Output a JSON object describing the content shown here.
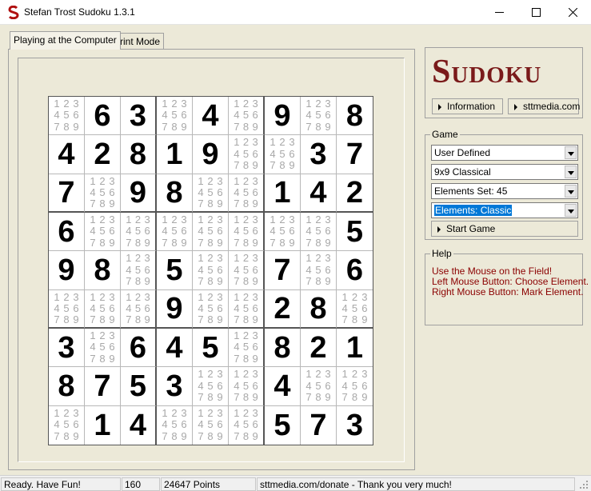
{
  "window": {
    "title": "Stefan Trost Sudoku 1.3.1"
  },
  "tabs": [
    {
      "label": "Playing at the Computer"
    },
    {
      "label": "Print Mode"
    }
  ],
  "logo": {
    "text": "Sudoku",
    "color": "#7a1a1a"
  },
  "links": {
    "information": "Information",
    "website": "sttmedia.com"
  },
  "game": {
    "title": "Game",
    "mode": "User Defined",
    "size": "9x9 Classical",
    "elements_set": "Elements Set: 45",
    "elements": "Elements: Classic",
    "start_label": "Start Game"
  },
  "help": {
    "title": "Help",
    "lines": [
      "Use the Mouse on the Field!",
      "Left Mouse Button: Choose Element.",
      "Right Mouse Button: Mark Element."
    ]
  },
  "board": {
    "rows": [
      "0,6,3,0,4,0,9,0,8",
      "4,2,8,1,9,0,0,3,7",
      "7,0,9,8,0,0,1,4,2",
      "6,0,0,0,0,0,0,0,5",
      "9,8,0,5,0,0,7,0,6",
      "0,0,0,9,0,0,2,8,0",
      "3,0,6,4,5,0,8,2,1",
      "8,7,5,3,0,0,4,0,0",
      "0,1,4,0,0,0,5,7,3"
    ],
    "candidates": "1 2 3 4 5 6 7 8 9"
  },
  "status": {
    "message": "Ready. Have Fun!",
    "count": "160",
    "points": "24647 Points",
    "donate": "sttmedia.com/donate - Thank you very much!"
  }
}
